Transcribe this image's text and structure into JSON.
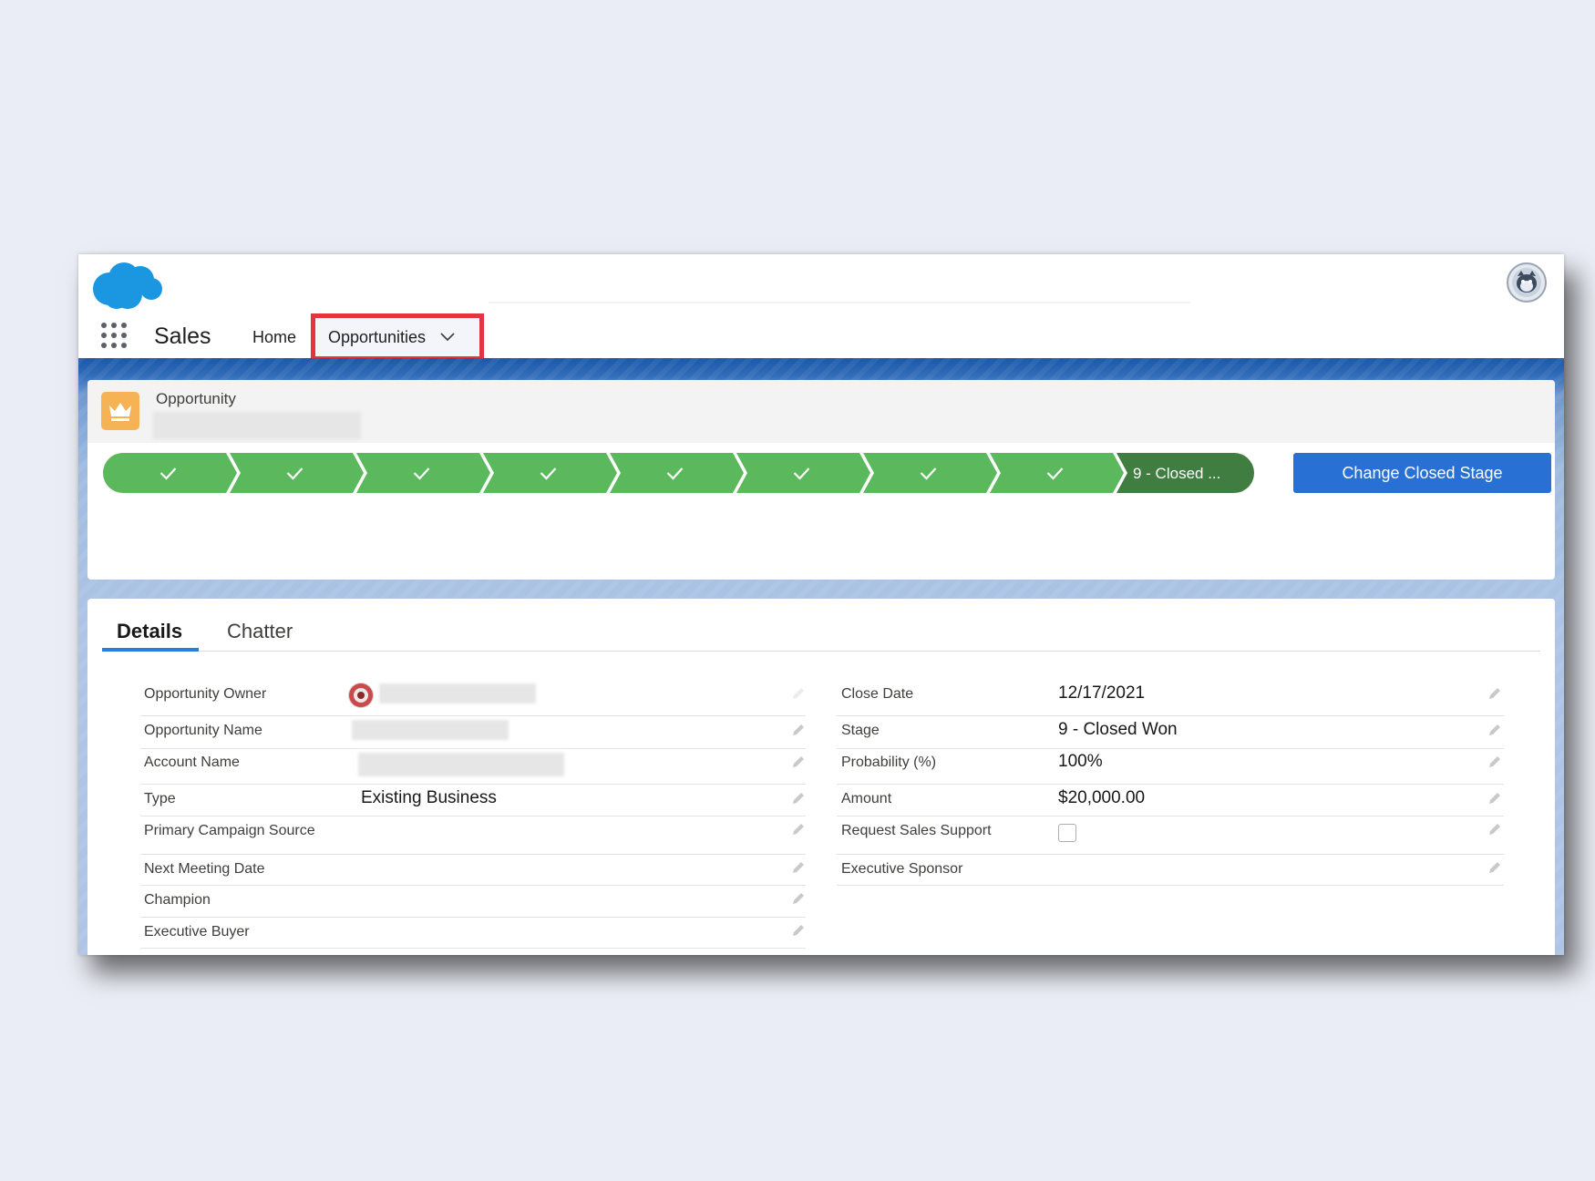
{
  "header": {
    "app_name": "Sales",
    "nav": {
      "home_label": "Home",
      "opportunities_label": "Opportunities"
    }
  },
  "record": {
    "object_label": "Opportunity",
    "change_stage_button": "Change Closed Stage",
    "path": {
      "completed_steps": 8,
      "current_step_label": "9 - Closed ...",
      "colors": {
        "complete": "#5bb85d",
        "current": "#3f7d40"
      }
    }
  },
  "tabs": {
    "details": "Details",
    "chatter": "Chatter"
  },
  "left_fields": [
    {
      "label": "Opportunity Owner",
      "value": ""
    },
    {
      "label": "Opportunity Name",
      "value": ""
    },
    {
      "label": "Account Name",
      "value": ""
    },
    {
      "label": "Type",
      "value": "Existing Business"
    },
    {
      "label": "Primary Campaign Source",
      "value": ""
    },
    {
      "label": "Next Meeting Date",
      "value": ""
    },
    {
      "label": "Champion",
      "value": ""
    },
    {
      "label": "Executive Buyer",
      "value": ""
    }
  ],
  "right_fields": [
    {
      "label": "Close Date",
      "value": "12/17/2021"
    },
    {
      "label": "Stage",
      "value": "9 - Closed Won"
    },
    {
      "label": "Probability (%)",
      "value": "100%"
    },
    {
      "label": "Amount",
      "value": "$20,000.00"
    },
    {
      "label": "Request Sales Support",
      "value": "",
      "checked": false
    },
    {
      "label": "Executive Sponsor",
      "value": ""
    }
  ],
  "theme": {
    "brand_blue": "#2870d3",
    "highlight_red": "#e3343f",
    "cloud_blue": "#1b96e0"
  }
}
